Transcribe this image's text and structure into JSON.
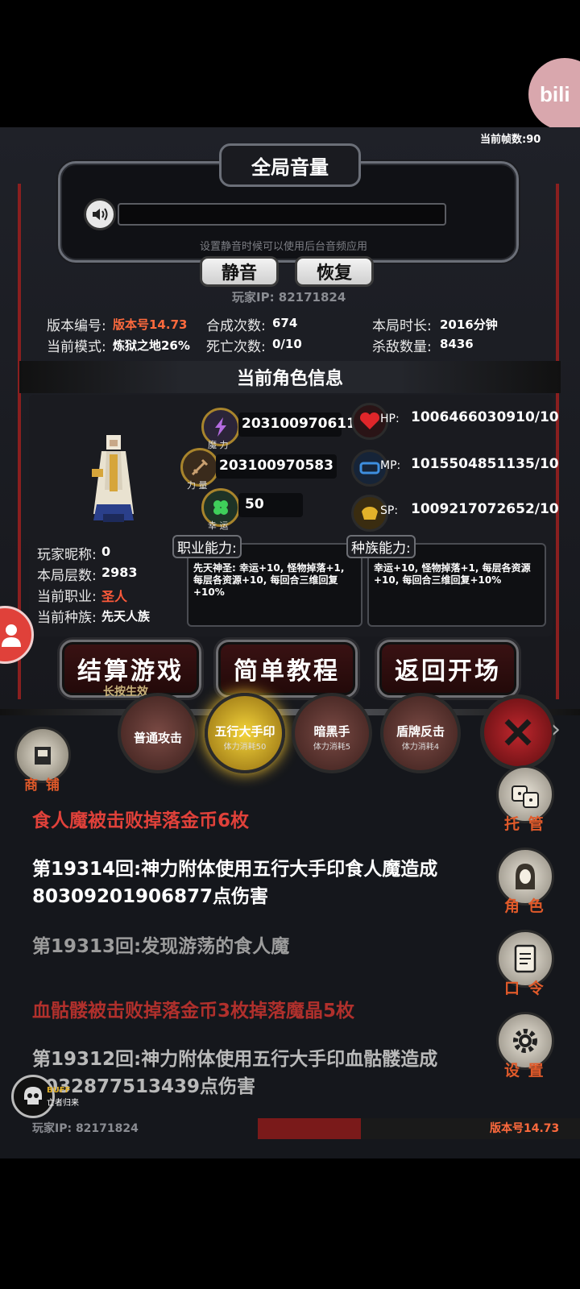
{
  "fps": "当前帧数:90",
  "volume": {
    "title": "全局音量",
    "hint": "设置静音时候可以使用后台音频应用",
    "mute_label": "静音",
    "restore_label": "恢复",
    "player_ip": "玩家IP:  82171824"
  },
  "stats": {
    "version_label": "版本编号:",
    "version_value": "版本号14.73",
    "mode_label": "当前模式:",
    "mode_value": "炼狱之地26%",
    "craft_label": "合成次数:",
    "craft_value": "674",
    "death_label": "死亡次数:",
    "death_value": "0/10",
    "time_label": "本局时长:",
    "time_value": "2016分钟",
    "kills_label": "杀敌数量:",
    "kills_value": "8436"
  },
  "character": {
    "section_title": "当前角色信息",
    "magic_value": "203100970611",
    "magic_label": "魔 力",
    "power_value": "203100970583",
    "power_label": "力 量",
    "luck_value": "50",
    "luck_label": "幸 运",
    "hp_label": "HP:",
    "hp_value": "1006466030910/10",
    "mp_label": "MP:",
    "mp_value": "1015504851135/10",
    "sp_label": "SP:",
    "sp_value": "1009217072652/10",
    "nickname_label": "玩家昵称:",
    "nickname_value": "0",
    "floors_label": "本局层数:",
    "floors_value": "2983",
    "job_label": "当前职业:",
    "job_value": "圣人",
    "race_label": "当前种族:",
    "race_value": "先天人族",
    "job_ability_title": "职业能力:",
    "job_ability_text": "先天神圣: 幸运+10, 怪物掉落+1, 每层各资源+10, 每回合三维回复+10%",
    "race_ability_title": "种族能力:",
    "race_ability_text": "幸运+10, 怪物掉落+1, 每层各资源+10, 每回合三维回复+10%"
  },
  "actions": {
    "settle_label": "结算游戏",
    "settle_sub": "长按生效",
    "tutorial_label": "简单教程",
    "return_label": "返回开场"
  },
  "skills": [
    {
      "name": "普通攻击",
      "cost": ""
    },
    {
      "name": "五行大手印",
      "cost": "体力消耗50"
    },
    {
      "name": "暗黑手",
      "cost": "体力消耗5"
    },
    {
      "name": "盾牌反击",
      "cost": "体力消耗4"
    }
  ],
  "shop_label": "商 铺",
  "side": {
    "auto_label": "托 管",
    "role_label": "角 色",
    "code_label": "口 令",
    "settings_label": "设 置"
  },
  "log": [
    {
      "text": "食人魔被击败掉落金币6枚",
      "color": "#e0413a"
    },
    {
      "text": "第19314回:神力附体使用五行大手印食人魔造成80309201906877点伤害",
      "color": "#ffffff"
    },
    {
      "text": "第19313回:发现游荡的食人魔",
      "color": "#9c9c9c"
    },
    {
      "text": "血骷髅被击败掉落金币3枚掉落魔晶5枚",
      "color": "#b0302c"
    },
    {
      "text": "第19312回:神力附体使用五行大手印血骷髅造成8032877513439点伤害",
      "color": "#b9b9b9"
    }
  ],
  "buff": {
    "label": "BUFF",
    "sub": "亡者归来"
  },
  "footer": {
    "ip": "玩家IP:  82171824",
    "version": "版本号14.73"
  },
  "overlay": {
    "bili": "bili"
  },
  "colors": {
    "accent_red": "#e0413a",
    "version_orange": "#ff6a3d"
  }
}
